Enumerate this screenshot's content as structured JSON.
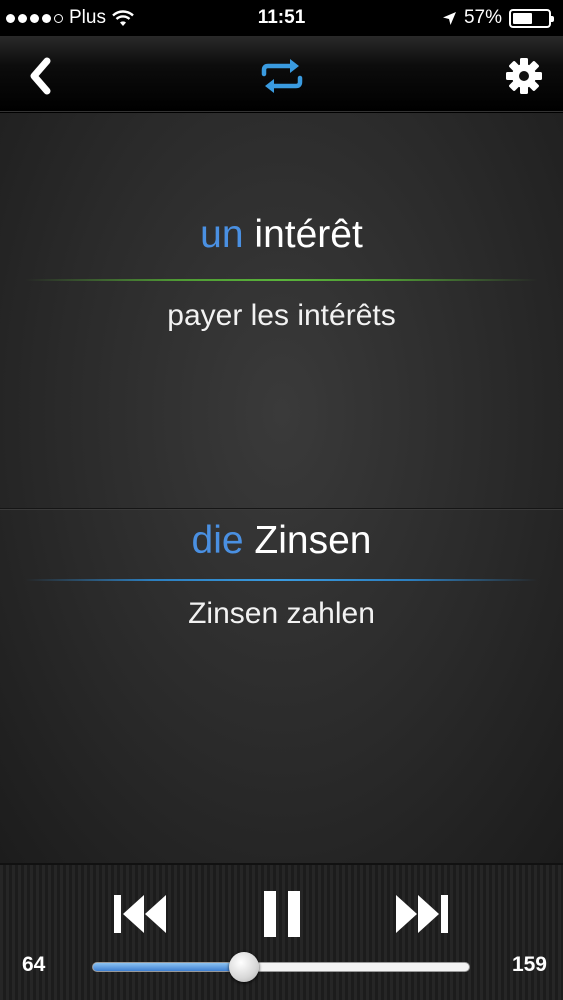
{
  "status_bar": {
    "carrier": "Plus",
    "time": "11:51",
    "battery": "57%",
    "battery_level": 0.57,
    "signal_bars": 4
  },
  "nav": {
    "back_icon": "chevron-left-icon",
    "repeat_icon": "repeat-icon",
    "settings_icon": "gear-icon",
    "accent_color": "#3a9be0"
  },
  "card_french": {
    "article": "un",
    "word": "intérêt",
    "example": "payer les intérêts",
    "divider_color": "#5ab43b"
  },
  "card_german": {
    "article": "die",
    "word": "Zinsen",
    "example": "Zinsen zahlen",
    "divider_color": "#3a9be0"
  },
  "player": {
    "current": "64",
    "total": "159",
    "progress": 0.4025,
    "prev_icon": "skip-back-icon",
    "pause_icon": "pause-icon",
    "next_icon": "skip-forward-icon"
  }
}
